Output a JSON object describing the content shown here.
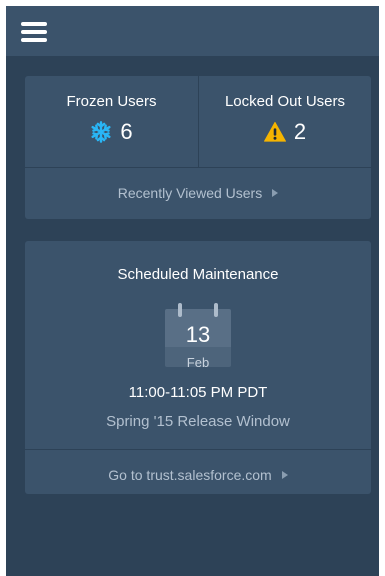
{
  "topbar": {
    "menu_icon": "hamburger-menu-icon"
  },
  "users_card": {
    "frozen": {
      "label": "Frozen Users",
      "count": "6",
      "icon": "snowflake-icon",
      "icon_color": "#29b6f6"
    },
    "locked": {
      "label": "Locked Out Users",
      "count": "2",
      "icon": "warning-triangle-icon",
      "icon_color": "#f5b400"
    },
    "recent_link": "Recently Viewed Users"
  },
  "maintenance_card": {
    "title": "Scheduled Maintenance",
    "calendar": {
      "day": "13",
      "month": "Feb"
    },
    "time": "11:00-11:05 PM PDT",
    "window": "Spring '15 Release Window",
    "trust_link": "Go to trust.salesforce.com"
  },
  "colors": {
    "background": "#2d4257",
    "card": "#3b536b",
    "muted_text": "#b2c0cf"
  }
}
